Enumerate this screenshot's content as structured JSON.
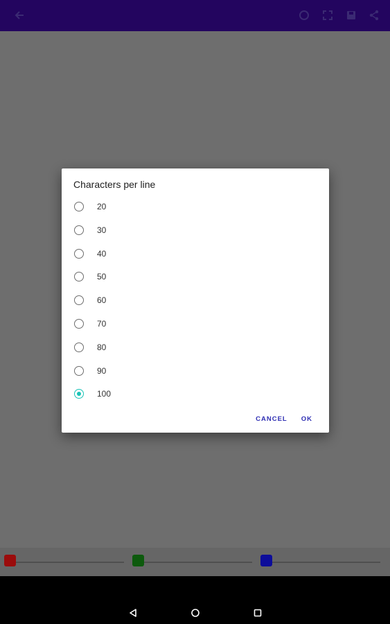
{
  "toolbar": {
    "icons": [
      "back-arrow-icon",
      "rotate-icon",
      "fullscreen-icon",
      "save-icon",
      "share-icon"
    ]
  },
  "dialog": {
    "title": "Characters per line",
    "options": [
      "20",
      "30",
      "40",
      "50",
      "60",
      "70",
      "80",
      "90",
      "100"
    ],
    "selected": "100",
    "cancel_label": "CANCEL",
    "ok_label": "OK"
  },
  "sliders": {
    "red": {
      "color": "#9b0c0c",
      "value": 0
    },
    "green": {
      "color": "#0d5a0d",
      "value": 0
    },
    "blue": {
      "color": "#0d0d9a",
      "value": 0
    }
  },
  "colors": {
    "appbar": "#23055f",
    "accent": "#19c3b6",
    "action_text": "#2f2fb3"
  },
  "navbar": {
    "icons": [
      "back-triangle-icon",
      "home-circle-icon",
      "recents-square-icon"
    ]
  }
}
